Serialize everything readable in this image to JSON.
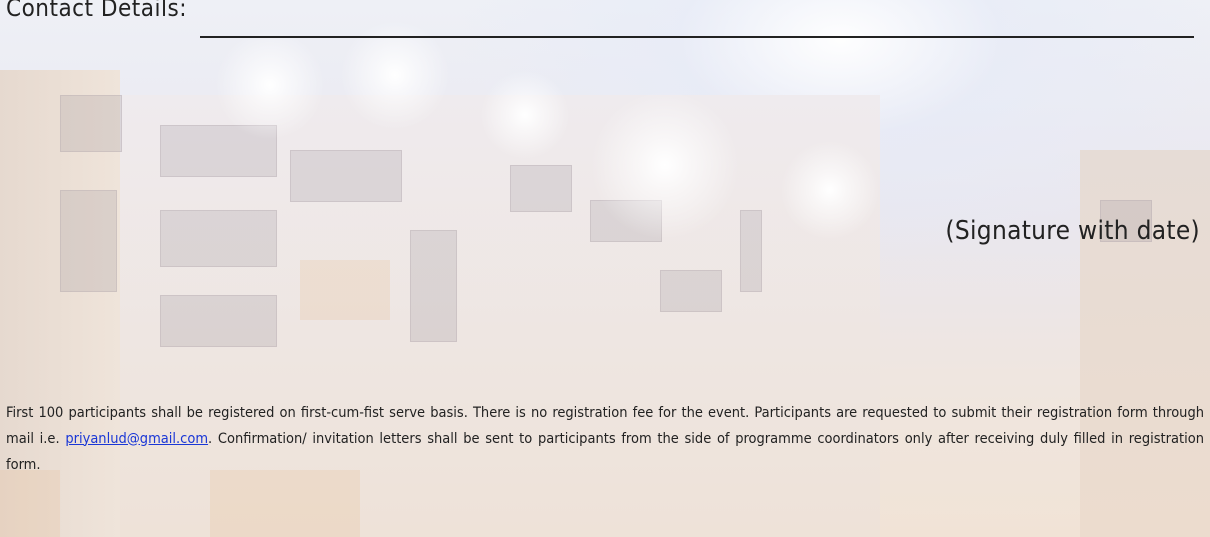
{
  "form": {
    "contact_label": "Contact Details: ",
    "signature_label": "(Signature with date)"
  },
  "notice": {
    "text_before_link": "First 100 participants shall be registered on first-cum-fist serve basis. There is no registration fee for the event.  Participants are requested to submit their registration form through mail i.e. ",
    "email_link": "priyanlud@gmail.com",
    "text_after_link": ". Confirmation/ invitation letters shall be sent to participants from the side of programme coordinators only after receiving duly filled in registration form."
  },
  "colors": {
    "link": "#1a37d6",
    "text": "#222222"
  }
}
